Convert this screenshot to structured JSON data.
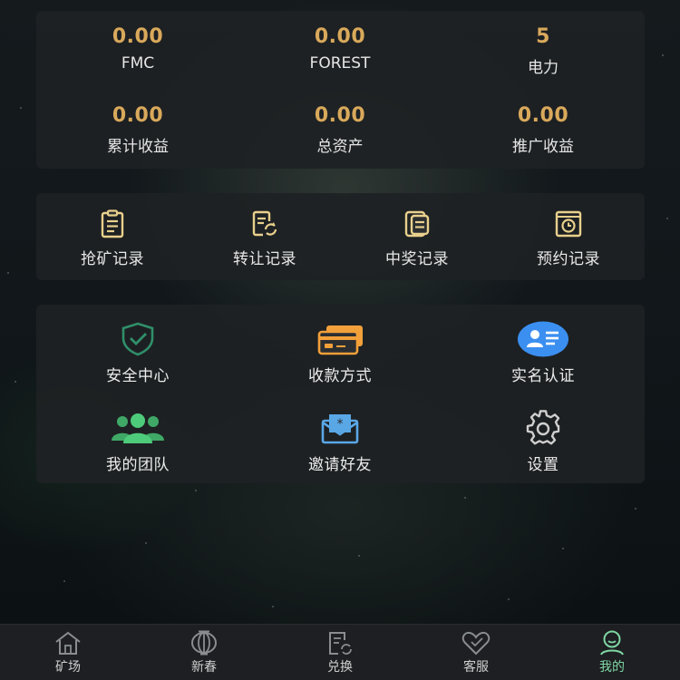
{
  "stats": [
    {
      "value": "0.00",
      "label": "FMC"
    },
    {
      "value": "0.00",
      "label": "FOREST"
    },
    {
      "value": "5",
      "label": "电力"
    },
    {
      "value": "0.00",
      "label": "累计收益"
    },
    {
      "value": "0.00",
      "label": "总资产"
    },
    {
      "value": "0.00",
      "label": "推广收益"
    }
  ],
  "records": [
    {
      "label": "抢矿记录",
      "icon": "clipboard-icon"
    },
    {
      "label": "转让记录",
      "icon": "transfer-doc-icon"
    },
    {
      "label": "中奖记录",
      "icon": "document-icon"
    },
    {
      "label": "预约记录",
      "icon": "clock-frame-icon"
    }
  ],
  "services": [
    {
      "label": "安全中心",
      "icon": "shield-check-icon"
    },
    {
      "label": "收款方式",
      "icon": "payment-card-icon"
    },
    {
      "label": "实名认证",
      "icon": "id-card-icon"
    },
    {
      "label": "我的团队",
      "icon": "team-icon"
    },
    {
      "label": "邀请好友",
      "icon": "invite-envelope-icon"
    },
    {
      "label": "设置",
      "icon": "gear-icon"
    }
  ],
  "tabbar": {
    "active": "我的",
    "tabs": [
      {
        "label": "矿场",
        "icon": "home-icon"
      },
      {
        "label": "新春",
        "icon": "lantern-icon"
      },
      {
        "label": "兑换",
        "icon": "exchange-icon"
      },
      {
        "label": "客服",
        "icon": "heart-icon"
      },
      {
        "label": "我的",
        "icon": "profile-icon"
      }
    ]
  },
  "colors": {
    "accent_gold": "#d9a95b",
    "accent_green": "#7fd6a3",
    "shield_green": "#2f8f6a",
    "card_orange": "#f2a03a",
    "id_blue": "#3b8ff0",
    "team_green": "#4ecb7a",
    "invite_blue": "#5aa7e6"
  }
}
